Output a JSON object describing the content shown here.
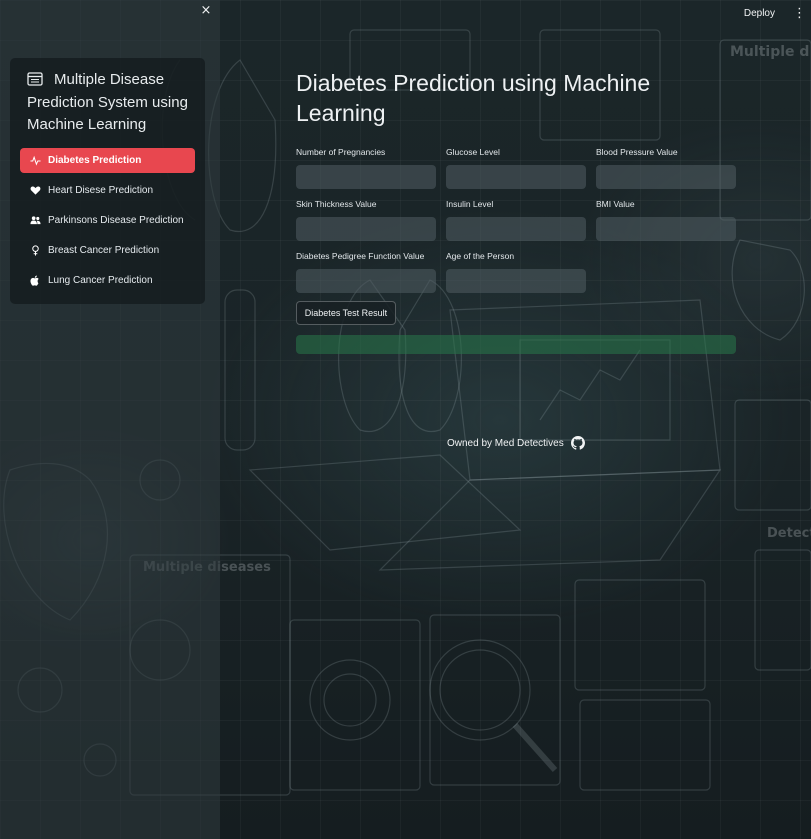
{
  "header": {
    "deploy_label": "Deploy",
    "menu_glyph": "⋮"
  },
  "sidebar": {
    "close_glyph": "×",
    "title": "Multiple Disease Prediction System using Machine Learning",
    "title_icon": "document-icon",
    "items": [
      {
        "label": "Diabetes Prediction",
        "icon": "activity-icon",
        "active": true
      },
      {
        "label": "Heart Disese Prediction",
        "icon": "heart-icon",
        "active": false
      },
      {
        "label": "Parkinsons Disease Prediction",
        "icon": "people-icon",
        "active": false
      },
      {
        "label": "Breast Cancer Prediction",
        "icon": "person-icon",
        "active": false
      },
      {
        "label": "Lung Cancer Prediction",
        "icon": "apple-icon",
        "active": false
      }
    ]
  },
  "main": {
    "title": "Diabetes Prediction using Machine Learning",
    "fields": [
      {
        "label": "Number of Pregnancies",
        "value": ""
      },
      {
        "label": "Glucose Level",
        "value": ""
      },
      {
        "label": "Blood Pressure Value",
        "value": ""
      },
      {
        "label": "Skin Thickness Value",
        "value": ""
      },
      {
        "label": "Insulin Level",
        "value": ""
      },
      {
        "label": "BMI Value",
        "value": ""
      },
      {
        "label": "Diabetes Pedigree Function Value",
        "value": ""
      },
      {
        "label": "Age of the Person",
        "value": ""
      }
    ],
    "submit_label": "Diabetes Test Result",
    "result_text": ""
  },
  "footer": {
    "text": "Owned by Med Detectives",
    "icon": "github-icon"
  },
  "background_labels": {
    "top_right": "Multiple d",
    "mid_left": "Multiple diseases",
    "right_mid": "Detect"
  },
  "colors": {
    "accent": "#e8474f",
    "success": "#2f7a4e"
  }
}
